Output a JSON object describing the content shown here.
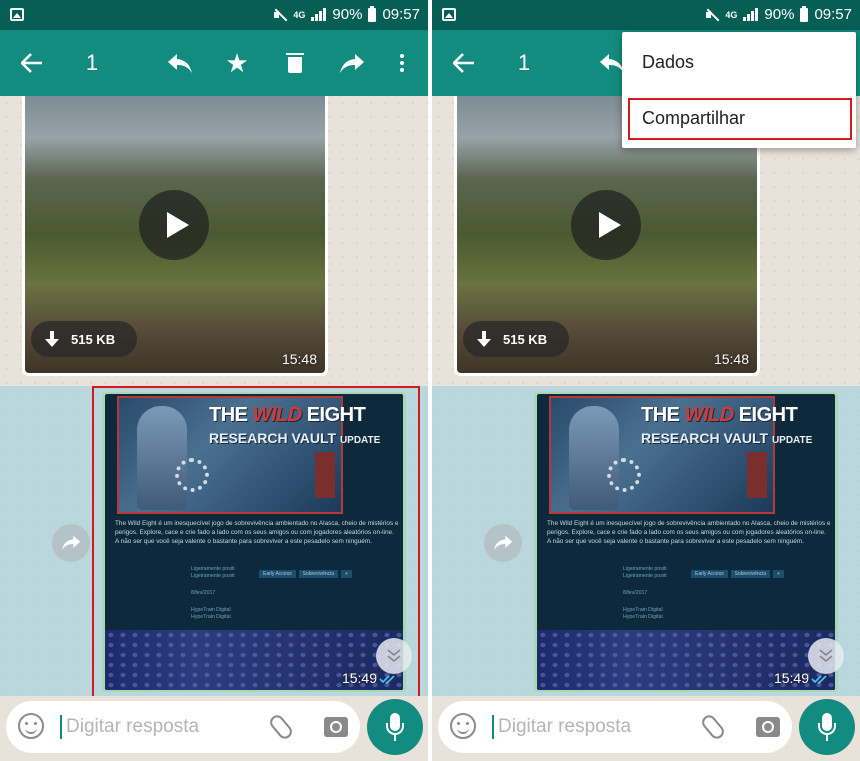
{
  "status_bar": {
    "network": "4G",
    "battery": "90%",
    "time": "09:57"
  },
  "action_bar": {
    "back_icon": "arrow-back-icon",
    "selected_count": "1",
    "reply_icon": "reply-icon",
    "star_icon": "star-icon",
    "delete_icon": "trash-icon",
    "forward_icon": "forward-icon",
    "more_icon": "more-vert-icon",
    "color": "#128c7e"
  },
  "video_message": {
    "size": "515 KB",
    "time": "15:48"
  },
  "image_message": {
    "title_the": "THE",
    "title_wild": "WILD",
    "title_eight": "EIGHT",
    "subtitle": "RESEARCH VAULT",
    "subtitle_small": "UPDATE",
    "description": "The Wild Eight é um inesquecível jogo de sobrevivência ambientado no Alasca, cheio de mistérios e perigos. Explore, cace e crie fado a lado com os seus amigos ou com jogadores aleatórios on-line. A não ser que você seja valente o bastante para sobreviver a este pesadelo sem ninguém.",
    "meta_values": [
      "Ligeiramente positi",
      "Ligeiramente positi",
      "8/fev/2017",
      "HypeTrain Digital",
      "HypeTrain Digital"
    ],
    "tags": [
      "Early Access",
      "Sobrevivência",
      "+"
    ],
    "time": "15:49"
  },
  "input": {
    "placeholder": "Digitar resposta"
  },
  "menu": {
    "items": [
      "Dados",
      "Compartilhar"
    ]
  },
  "colors": {
    "highlight": "#d11a1a",
    "accent": "#128c7e",
    "status_bar": "#075e54"
  }
}
